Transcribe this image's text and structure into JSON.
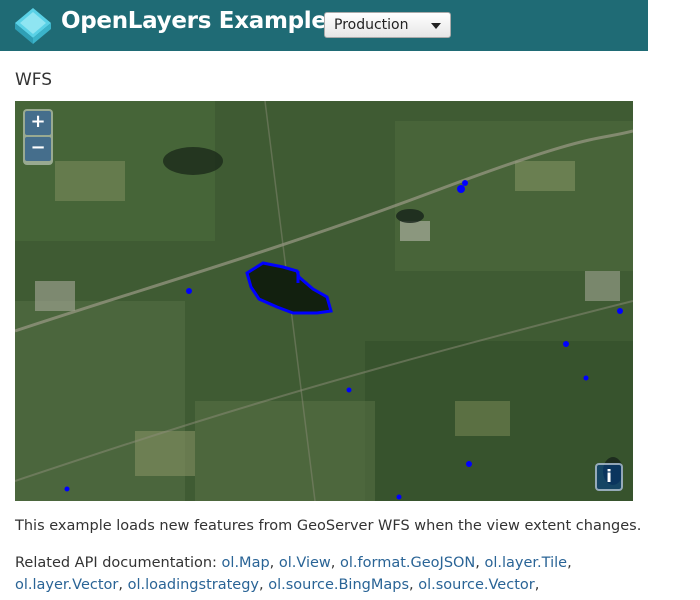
{
  "header": {
    "brand": "OpenLayers Examples",
    "version_select": "Production"
  },
  "page": {
    "title": "WFS",
    "description": "This example loads new features from GeoServer WFS when the view extent changes.",
    "related_label": "Related API documentation:"
  },
  "map": {
    "zoom_in": "+",
    "zoom_out": "−",
    "attribution_button": "i",
    "feature_color": "#0000ff"
  },
  "api_links": [
    "ol.Map",
    "ol.View",
    "ol.format.GeoJSON",
    "ol.layer.Tile",
    "ol.layer.Vector",
    "ol.loadingstrategy",
    "ol.source.BingMaps",
    "ol.source.Vector"
  ],
  "colors": {
    "navbar": "#1f6b75",
    "link": "#2a6496"
  }
}
